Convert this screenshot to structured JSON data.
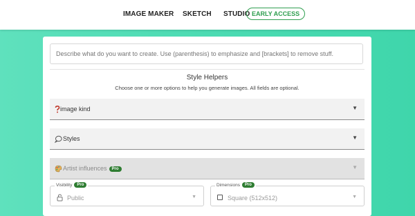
{
  "nav": {
    "image_maker": "IMAGE MAKER",
    "sketch": "SKETCH",
    "studio": "STUDIO",
    "early_access": "EARLY ACCESS"
  },
  "prompt": {
    "placeholder": "Describe what do you want to create. Use (parenthesis) to emphasize and [brackets] to remove stuff."
  },
  "style_helpers": {
    "title": "Style Helpers",
    "subtitle": "Choose one or more options to help you generate images. All fields are optional."
  },
  "accordions": {
    "image_kind": {
      "label": "image kind",
      "icon": "question-mark-icon"
    },
    "styles": {
      "label": "Styles",
      "icon": "speech-bubble-icon"
    },
    "artist": {
      "label": "Artist influences",
      "icon": "palette-icon",
      "badge": "Pro"
    }
  },
  "fields": {
    "visibility": {
      "label": "Visibility",
      "badge": "Pro",
      "value": "Public",
      "icon": "lock-icon"
    },
    "dimensions": {
      "label": "Dimensions",
      "badge": "Pro",
      "value": "Square (512x512)",
      "icon": "checkbox-icon"
    }
  },
  "colors": {
    "accent": "#2f9e4f",
    "pro_badge": "#2f7d32",
    "background": "#4fdcb4"
  }
}
